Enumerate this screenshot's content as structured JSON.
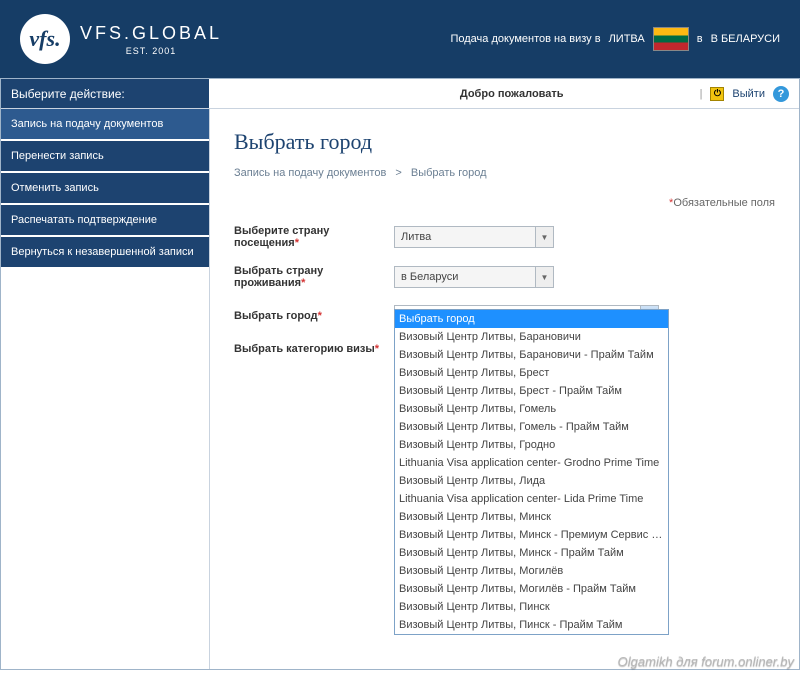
{
  "header": {
    "brand_main": "VFS.GLOBAL",
    "brand_sub": "EST. 2001",
    "logo_text": "vfs.",
    "visa_text_prefix": "Подача документов на визу в ",
    "country_dest": "ЛИТВА",
    "location_prefix": " в ",
    "country_reside": "В БЕЛАРУСИ"
  },
  "topbar": {
    "left_label": "Выберите действие:",
    "welcome": "Добро пожаловать",
    "logout": "Выйти"
  },
  "sidebar": {
    "items": [
      {
        "label": "Запись на подачу документов"
      },
      {
        "label": "Перенести запись"
      },
      {
        "label": "Отменить запись"
      },
      {
        "label": "Распечатать подтверждение"
      },
      {
        "label": "Вернуться к незавершенной записи"
      }
    ]
  },
  "page": {
    "title": "Выбрать город",
    "breadcrumb_1": "Запись на подачу документов",
    "breadcrumb_2": "Выбрать город",
    "required_note": "Обязательные поля",
    "asterisk": "*"
  },
  "form": {
    "visiting_country_label": "Выберите страну посещения",
    "visiting_country_value": "Литва",
    "residence_country_label": "Выбрать страну проживания",
    "residence_country_value": "в Беларуси",
    "select_city_label": "Выбрать город",
    "select_city_value": "Выбрать город",
    "visa_category_label": "Выбрать категорию визы"
  },
  "dropdown": {
    "items": [
      "Выбрать город",
      "Визовый Центр Литвы, Барановичи",
      "Визовый Центр Литвы, Барановичи - Прайм Тайм",
      "Визовый Центр Литвы, Брест",
      "Визовый Центр Литвы, Брест - Прайм Тайм",
      "Визовый Центр Литвы, Гомель",
      "Визовый Центр Литвы, Гомель - Прайм Тайм",
      "Визовый Центр Литвы, Гродно",
      "Lithuania Visa application center- Grodno Prime Time",
      "Визовый Центр Литвы, Лида",
      "Lithuania Visa application center- Lida Prime Time",
      "Визовый Центр Литвы, Минск",
      "Визовый Центр Литвы, Минск - Премиум Сервис Зал",
      "Визовый Центр Литвы, Минск - Прайм Тайм",
      "Визовый Центр Литвы, Могилёв",
      "Визовый Центр Литвы, Могилёв - Прайм Тайм",
      "Визовый Центр Литвы, Пинск",
      "Визовый Центр Литвы, Пинск - Прайм Тайм"
    ]
  },
  "watermark": "Olgamikh для forum.onliner.by"
}
